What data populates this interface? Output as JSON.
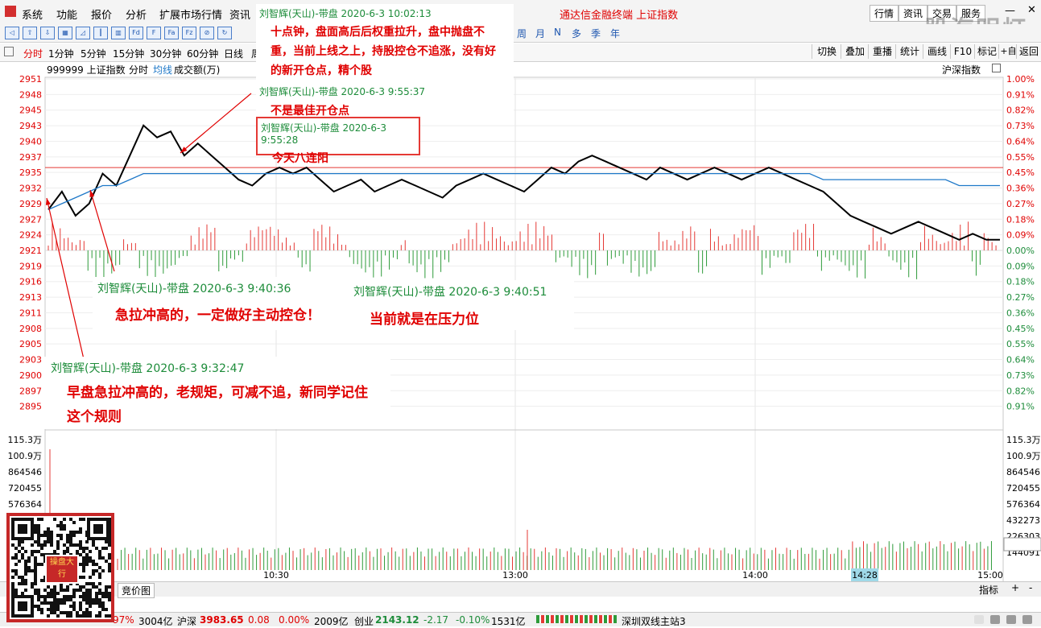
{
  "menu": {
    "items": [
      "系统",
      "功能",
      "报价",
      "分析",
      "扩展市场行情",
      "资讯"
    ],
    "title": "通达信金融终端  上证指数",
    "right": [
      "行情",
      "资讯",
      "交易",
      "服务"
    ],
    "watermark": "股海明灯"
  },
  "toolbar": {
    "icons": [
      "back-arrow-icon",
      "up-arrow-icon",
      "down-arrow-icon",
      "list-icon",
      "chart-icon",
      "kline-icon",
      "grid-icon",
      "f10-icon",
      "f-icon",
      "fa-icon",
      "fz-icon",
      "ban-icon",
      "refresh-icon"
    ],
    "icon_labels": [
      "◁",
      "⇧",
      "⇩",
      "▦",
      "◿",
      "┃",
      "▥",
      "Fd",
      "F",
      "Fa",
      "Fz",
      "⊘",
      "↻"
    ],
    "periods_tail": [
      "周",
      "月",
      "N",
      "多",
      "季",
      "年"
    ]
  },
  "periodbar": {
    "tabs": [
      "分时",
      "1分钟",
      "5分钟",
      "15分钟",
      "30分钟",
      "60分钟",
      "日线",
      "周"
    ],
    "right_buttons": [
      "切换",
      "叠加",
      "重播",
      "统计",
      "画线",
      "F10",
      "标记",
      "+自选",
      "返回"
    ]
  },
  "info": {
    "code_name": "999999 上证指数",
    "mode": "分时",
    "avg_line": "均线",
    "volume": "成交额(万)",
    "index_label": "沪深指数"
  },
  "price_axis": {
    "left": [
      "2951",
      "2948",
      "2945",
      "2943",
      "2940",
      "2937",
      "2935",
      "2932",
      "2929",
      "2927",
      "2924",
      "2921",
      "2919",
      "2916",
      "2913",
      "2911",
      "2908",
      "2905",
      "2903",
      "2900",
      "2897",
      "2895"
    ],
    "right": [
      "1.00%",
      "0.91%",
      "0.82%",
      "0.73%",
      "0.64%",
      "0.55%",
      "0.45%",
      "0.36%",
      "0.27%",
      "0.18%",
      "0.09%",
      "0.00%",
      "0.09%",
      "0.18%",
      "0.27%",
      "0.36%",
      "0.45%",
      "0.55%",
      "0.64%",
      "0.73%",
      "0.82%",
      "0.91%"
    ]
  },
  "volume_axis": {
    "left": [
      "115.3万",
      "100.9万",
      "864546",
      "720455",
      "576364"
    ],
    "right": [
      "115.3万",
      "100.9万",
      "864546",
      "720455",
      "576364",
      "432273",
      "226303",
      "144091"
    ]
  },
  "time_axis": {
    "labels": [
      "10:30",
      "13:00",
      "14:00",
      "15:00"
    ],
    "cursor": "14:28"
  },
  "chart_data": {
    "type": "line",
    "title": "上证指数 分时",
    "series": [
      {
        "name": "999999 上证指数",
        "color": "#000000",
        "values": [
          2929,
          2932,
          2928,
          2930,
          2935,
          2933,
          2938,
          2943,
          2941,
          2942,
          2938,
          2940,
          2938,
          2936,
          2934,
          2933,
          2935,
          2936,
          2935,
          2936,
          2934,
          2932,
          2933,
          2934,
          2932,
          2933,
          2934,
          2933,
          2932,
          2931,
          2933,
          2934,
          2935,
          2934,
          2933,
          2932,
          2934,
          2936,
          2935,
          2937,
          2938,
          2937,
          2936,
          2935,
          2934,
          2936,
          2935,
          2934,
          2935,
          2936,
          2935,
          2934,
          2935,
          2936,
          2935,
          2934,
          2933,
          2932,
          2930,
          2928,
          2927,
          2926,
          2925,
          2926,
          2927,
          2926,
          2925,
          2924,
          2925,
          2924,
          2924
        ]
      },
      {
        "name": "均线",
        "color": "#1e78c8",
        "values": [
          2929,
          2930,
          2931,
          2932,
          2933,
          2933,
          2934,
          2935,
          2935,
          2935,
          2935,
          2935,
          2935,
          2935,
          2935,
          2935,
          2935,
          2935,
          2935,
          2935,
          2935,
          2935,
          2935,
          2935,
          2935,
          2935,
          2935,
          2935,
          2935,
          2935,
          2935,
          2935,
          2935,
          2935,
          2935,
          2935,
          2935,
          2935,
          2935,
          2935,
          2935,
          2935,
          2935,
          2935,
          2935,
          2935,
          2935,
          2935,
          2935,
          2935,
          2935,
          2935,
          2935,
          2935,
          2935,
          2935,
          2935,
          2934,
          2934,
          2934,
          2934,
          2934,
          2934,
          2934,
          2934,
          2934,
          2934,
          2933,
          2933,
          2933,
          2933
        ]
      }
    ],
    "reference_line": 2936,
    "ylim": [
      2894,
      2951
    ]
  },
  "annotations": [
    {
      "header": "刘智辉(天山)-带盘 2020-6-3 10:02:13",
      "body": "十点钟，盘面高后后权重拉升，盘中抛盘不重，当前上线之上，持股控仓不追涨，没有好的新开仓点，精个股"
    },
    {
      "header": "刘智辉(天山)-带盘 2020-6-3 9:55:37",
      "body": "不是最佳开仓点"
    },
    {
      "header": "刘智辉(天山)-带盘 2020-6-3 9:55:28",
      "body": "今天八连阳"
    },
    {
      "header": "刘智辉(天山)-带盘 2020-6-3 9:40:36",
      "body": "急拉冲高的，一定做好主动控仓！"
    },
    {
      "header": "刘智辉(天山)-带盘 2020-6-3 9:40:51",
      "body": "当前就是在压力位"
    },
    {
      "header": "刘智辉(天山)-带盘 2020-6-3 9:32:47",
      "body": "早盘急拉冲高的，老规矩，可减不追，新同学记住这个规则"
    }
  ],
  "bottom": {
    "tab": "竞价图",
    "right": [
      "指标",
      "+",
      "-"
    ]
  },
  "status": {
    "items": [
      {
        "text": "97%",
        "color": "#e00000"
      },
      {
        "text": "3004亿",
        "color": "#000000"
      },
      {
        "text": "沪深",
        "color": "#000000"
      },
      {
        "text": "3983.65",
        "color": "#e00000"
      },
      {
        "text": "0.08",
        "color": "#e00000"
      },
      {
        "text": "0.00%",
        "color": "#e00000"
      },
      {
        "text": "2009亿",
        "color": "#000000"
      },
      {
        "text": "创业",
        "color": "#000000"
      },
      {
        "text": "2143.12",
        "color": "#1d8c3a"
      },
      {
        "text": "-2.17",
        "color": "#1d8c3a"
      },
      {
        "text": "-0.10%",
        "color": "#1d8c3a"
      },
      {
        "text": "1531亿",
        "color": "#000000"
      },
      {
        "text": "深圳双线主站3",
        "color": "#000000"
      }
    ]
  },
  "qr": {
    "badge": "操盘大行"
  }
}
